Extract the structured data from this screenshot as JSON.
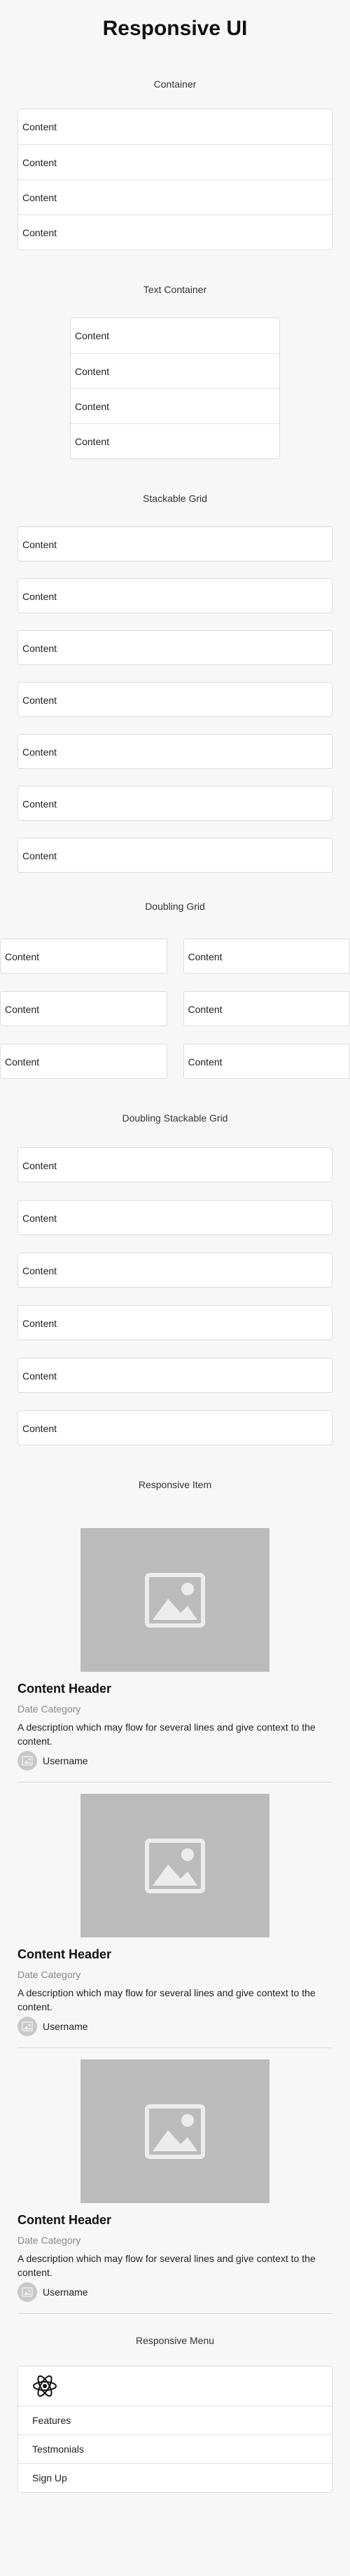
{
  "title": "Responsive UI",
  "sections": {
    "container": {
      "label": "Container",
      "rows": [
        "Content",
        "Content",
        "Content",
        "Content"
      ]
    },
    "text_container": {
      "label": "Text Container",
      "rows": [
        "Content",
        "Content",
        "Content",
        "Content"
      ]
    },
    "stackable_grid": {
      "label": "Stackable Grid",
      "cards": [
        "Content",
        "Content",
        "Content",
        "Content",
        "Content",
        "Content",
        "Content"
      ]
    },
    "doubling_grid": {
      "label": "Doubling Grid",
      "rows": [
        [
          "Content",
          "Content"
        ],
        [
          "Content",
          "Content"
        ],
        [
          "Content",
          "Content"
        ]
      ]
    },
    "doubling_stackable_grid": {
      "label": "Doubling Stackable Grid",
      "cards": [
        "Content",
        "Content",
        "Content",
        "Content",
        "Content",
        "Content"
      ]
    },
    "responsive_item": {
      "label": "Responsive Item",
      "items": [
        {
          "header": "Content Header",
          "meta": "Date Category",
          "description": "A description which may flow for several lines and give context to the content.",
          "username": "Username",
          "image_icon": "image-icon",
          "avatar_icon": "image-icon"
        },
        {
          "header": "Content Header",
          "meta": "Date Category",
          "description": "A description which may flow for several lines and give context to the content.",
          "username": "Username",
          "image_icon": "image-icon",
          "avatar_icon": "image-icon"
        },
        {
          "header": "Content Header",
          "meta": "Date Category",
          "description": "A description which may flow for several lines and give context to the content.",
          "username": "Username",
          "image_icon": "image-icon",
          "avatar_icon": "image-icon"
        }
      ]
    },
    "responsive_menu": {
      "label": "Responsive Menu",
      "logo_icon": "react-logo-icon",
      "items": [
        "Features",
        "Testmonials",
        "Sign Up"
      ]
    }
  },
  "colors": {
    "background": "#f7f7f7",
    "card": "#ffffff",
    "border": "#dcdcdc",
    "image_placeholder": "#bbbbbb"
  }
}
